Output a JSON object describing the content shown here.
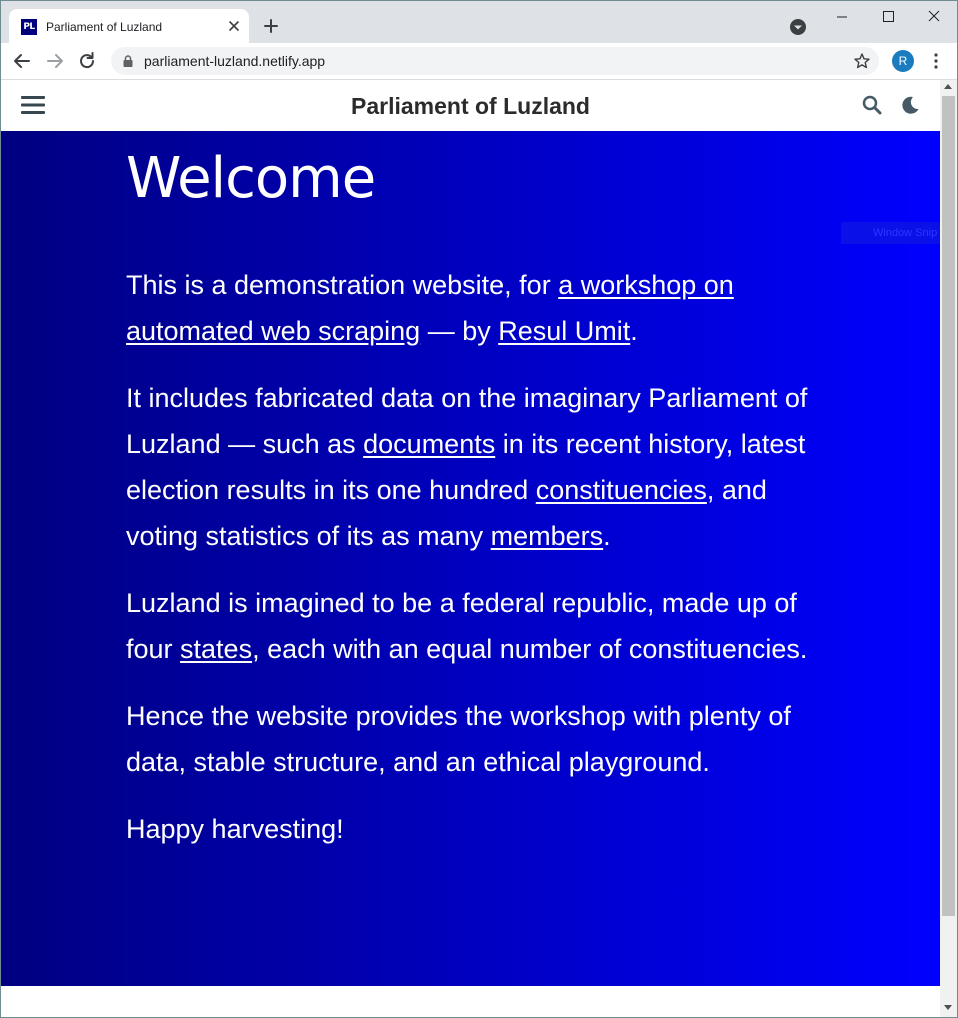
{
  "browser": {
    "tab": {
      "favicon_text": "PL",
      "title": "Parliament of Luzland"
    },
    "address": {
      "url": "parliament-luzland.netlify.app"
    },
    "profile_initial": "R"
  },
  "site": {
    "title": "Parliament of Luzland"
  },
  "hero": {
    "title": "Welcome",
    "overlay_text": "Window Snip",
    "p1": {
      "t1": "This is a demonstration website, for ",
      "link1": "a workshop on automated web scraping",
      "t2": " — by ",
      "link2": "Resul Umit",
      "t3": "."
    },
    "p2": {
      "t1": "It includes fabricated data on the imaginary Parliament of Luzland — such as ",
      "link1": "documents",
      "t2": " in its recent history, latest election results in its one hundred ",
      "link2": "constituencies",
      "t3": ", and voting statistics of its as many ",
      "link3": "members",
      "t4": "."
    },
    "p3": {
      "t1": "Luzland is imagined to be a federal republic, made up of four ",
      "link1": "states",
      "t2": ", each with an equal number of constituencies."
    },
    "p4": "Hence the website provides the workshop with plenty of data, stable structure, and an ethical playground.",
    "p5": "Happy harvesting!"
  },
  "colors": {
    "hero_start": "#000080",
    "hero_end": "#0000ff",
    "header_text": "#2b2b2b",
    "tabstrip": "#dee1e6"
  },
  "icons": [
    "close-icon",
    "plus-icon",
    "tab-search-icon",
    "minimize-icon",
    "maximize-icon",
    "window-close-icon",
    "back-icon",
    "forward-icon",
    "reload-icon",
    "lock-icon",
    "star-icon",
    "kebab-icon",
    "hamburger-icon",
    "search-icon",
    "moon-icon"
  ]
}
